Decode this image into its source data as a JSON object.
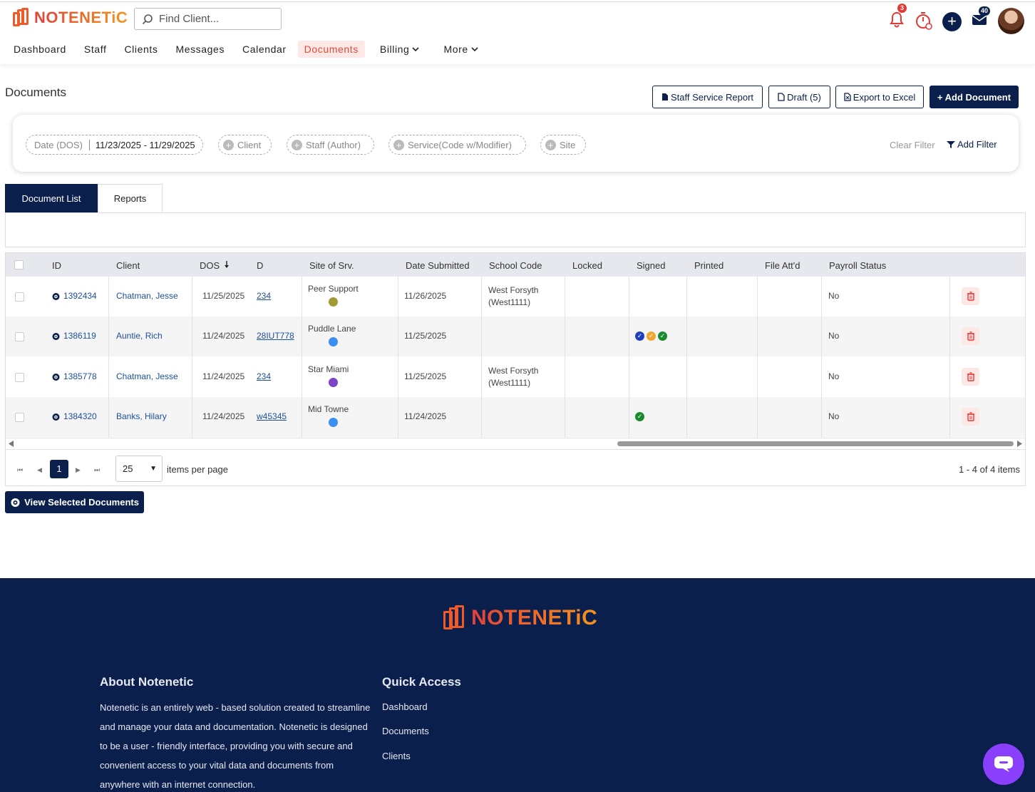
{
  "brand": {
    "name": "NOTENETiC",
    "accent": "#f05a28",
    "navy": "#0b1f4d"
  },
  "header": {
    "search_placeholder": "Find Client...",
    "notifications_count": "3",
    "messages_count": "40"
  },
  "nav": {
    "items": [
      "Dashboard",
      "Staff",
      "Clients",
      "Messages",
      "Calendar",
      "Documents",
      "Billing",
      "More"
    ],
    "active": "Documents"
  },
  "page": {
    "title": "Documents",
    "buttons": {
      "staff_service_report": "Staff Service Report",
      "draft": "Draft (5)",
      "export_excel": "Export to Excel",
      "add_document": "+ Add Document"
    }
  },
  "filters": {
    "date_label": "Date (DOS)",
    "date_value": "11/23/2025 - 11/29/2025",
    "client": "Client",
    "staff": "Staff (Author)",
    "service": "Service(Code w/Modifier)",
    "site": "Site",
    "clear": "Clear Filter",
    "add": "Add Filter"
  },
  "tabs": {
    "list": "Document List",
    "reports": "Reports"
  },
  "table": {
    "columns": [
      "ID",
      "Client",
      "DOS",
      "D",
      "Site of Srv.",
      "Date Submitted",
      "School Code",
      "Locked",
      "Signed",
      "Printed",
      "File Att'd",
      "Payroll Status"
    ],
    "rows": [
      {
        "id": "1392434",
        "client": "Chatman, Jesse",
        "dos": "11/25/2025",
        "d": "234",
        "site": "Peer Support",
        "site_color": "#a39a36",
        "submitted": "11/26/2025",
        "school1": "West Forsyth",
        "school2": "(West1111)",
        "signed": [],
        "payroll": "No"
      },
      {
        "id": "1386119",
        "client": "Auntie, Rich",
        "dos": "11/24/2025",
        "d": "28IUT778",
        "site": "Puddle Lane",
        "site_color": "#3b8ff3",
        "submitted": "11/25/2025",
        "school1": "",
        "school2": "",
        "signed": [
          "#1f3fbf",
          "#f2a531",
          "#1a8a2e"
        ],
        "payroll": "No"
      },
      {
        "id": "1385778",
        "client": "Chatman, Jesse",
        "dos": "11/24/2025",
        "d": "234",
        "site": "Star Miami",
        "site_color": "#7d44c9",
        "submitted": "11/25/2025",
        "school1": "West Forsyth",
        "school2": "(West1111)",
        "signed": [],
        "payroll": "No"
      },
      {
        "id": "1384320",
        "client": "Banks, Hilary",
        "dos": "11/24/2025",
        "d": "w45345",
        "site": "Mid Towne",
        "site_color": "#3b8ff3",
        "submitted": "11/24/2025",
        "school1": "",
        "school2": "",
        "signed": [
          "#1a8a2e"
        ],
        "payroll": "No"
      }
    ]
  },
  "pager": {
    "current_page": "1",
    "page_size": "25",
    "per_page_label": "items per page",
    "info": "1 - 4 of 4 items"
  },
  "view_selected": "View Selected Documents",
  "footer": {
    "about_title": "About Notenetic",
    "about_text": "Notenetic is an entirely web - based solution created to streamline and manage your data and documentation. Notenetic is designed to be a user - friendly interface, providing you with secure and convenient access to your vital data and documents from anywhere with an internet connection.",
    "quick_title": "Quick Access",
    "quick_links": [
      "Dashboard",
      "Documents",
      "Clients"
    ]
  }
}
